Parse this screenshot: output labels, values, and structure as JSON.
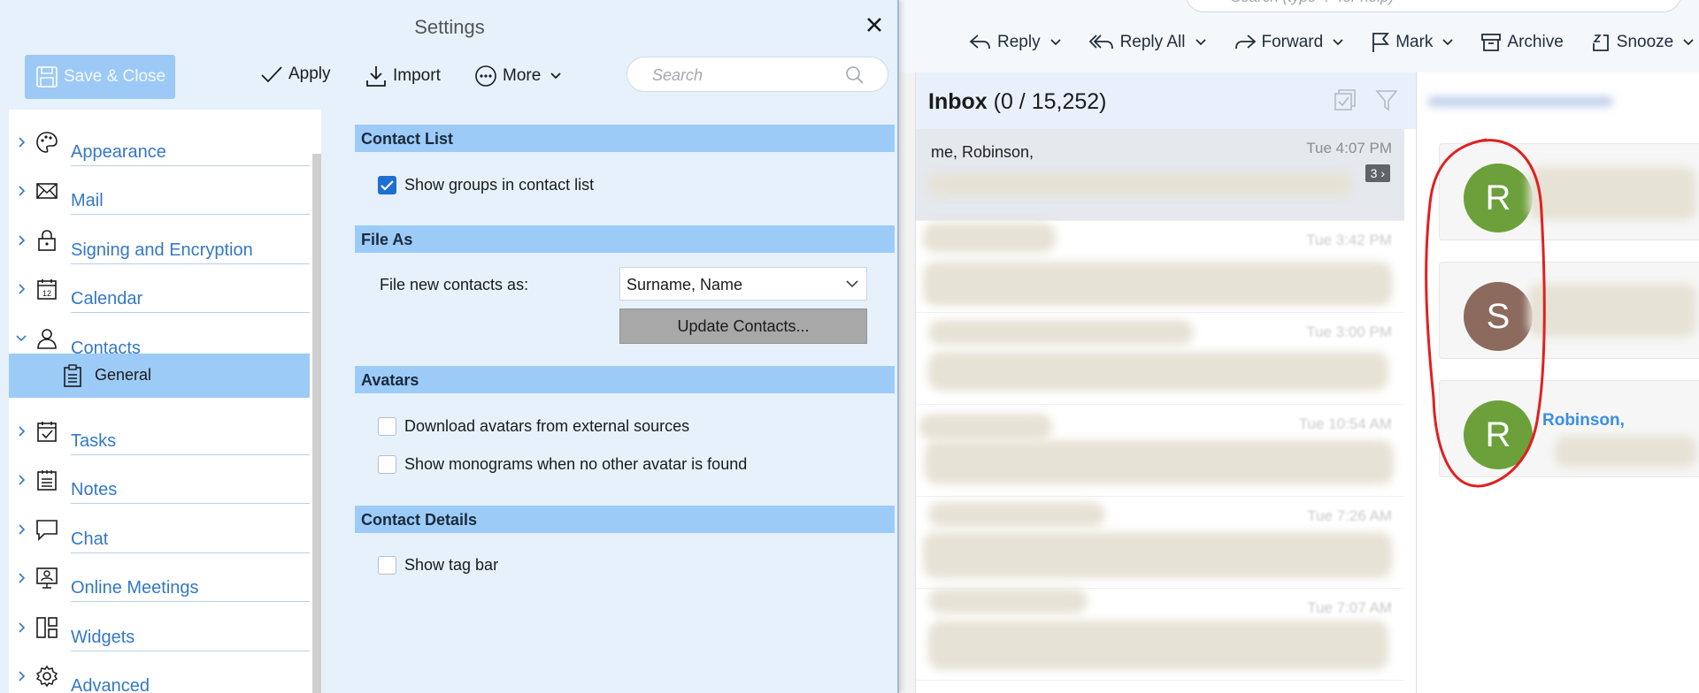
{
  "mail": {
    "search_placeholder": "Search (type '?' for help)",
    "toolbar": [
      {
        "label": "Reply",
        "icon": "reply-icon"
      },
      {
        "label": "Reply All",
        "icon": "reply-all-icon"
      },
      {
        "label": "Forward",
        "icon": "forward-icon"
      },
      {
        "label": "Mark",
        "icon": "flag-icon"
      },
      {
        "label": "Archive",
        "icon": "archive-icon"
      },
      {
        "label": "Snooze",
        "icon": "snooze-icon"
      }
    ],
    "inbox": {
      "title": "Inbox",
      "count": "(0 / 15,252)",
      "messages": [
        {
          "sender": "me, Robinson,",
          "time": "Tue 4:07 PM",
          "badge": "3 ›"
        },
        {
          "sender": "",
          "time": "Tue 3:42 PM"
        },
        {
          "sender": "",
          "time": "Tue 3:00 PM"
        },
        {
          "sender": "",
          "time": "Tue 10:54 AM"
        },
        {
          "sender": "",
          "time": "Tue 7:26 AM"
        },
        {
          "sender": "",
          "time": "Tue 7:07 AM"
        }
      ]
    },
    "contacts": [
      {
        "initial": "R",
        "color": "#6ba03a",
        "name": ""
      },
      {
        "initial": "S",
        "color": "#8c6a5e",
        "name": ""
      },
      {
        "initial": "R",
        "color": "#6ba03a",
        "name": "Robinson,"
      }
    ],
    "annotation_color": "#e02020"
  },
  "settings": {
    "title": "Settings",
    "save_close": "Save & Close",
    "apply": "Apply",
    "import": "Import",
    "more": "More",
    "search_placeholder": "Search",
    "nav": [
      {
        "label": "Appearance",
        "icon": "palette-icon"
      },
      {
        "label": "Mail",
        "icon": "envelope-icon"
      },
      {
        "label": "Signing and Encryption",
        "icon": "lock-icon"
      },
      {
        "label": "Calendar",
        "icon": "calendar-icon"
      },
      {
        "label": "Contacts",
        "icon": "person-icon",
        "expanded": true
      },
      {
        "label": "Tasks",
        "icon": "task-icon"
      },
      {
        "label": "Notes",
        "icon": "notes-icon"
      },
      {
        "label": "Chat",
        "icon": "chat-icon"
      },
      {
        "label": "Online Meetings",
        "icon": "meeting-icon"
      },
      {
        "label": "Widgets",
        "icon": "widgets-icon"
      },
      {
        "label": "Advanced",
        "icon": "gear-icon"
      }
    ],
    "nav_sub": {
      "label": "General",
      "icon": "clipboard-icon"
    },
    "sections": {
      "contact_list": {
        "title": "Contact List",
        "show_groups": {
          "label": "Show groups in contact list",
          "checked": true
        }
      },
      "file_as": {
        "title": "File As",
        "label": "File new contacts as:",
        "value": "Surname, Name",
        "update_button": "Update Contacts..."
      },
      "avatars": {
        "title": "Avatars",
        "download": {
          "label": "Download avatars from external sources",
          "checked": false
        },
        "monograms": {
          "label": "Show monograms when no other avatar is found",
          "checked": false
        }
      },
      "contact_details": {
        "title": "Contact Details",
        "tag_bar": {
          "label": "Show tag bar",
          "checked": false
        }
      }
    }
  }
}
